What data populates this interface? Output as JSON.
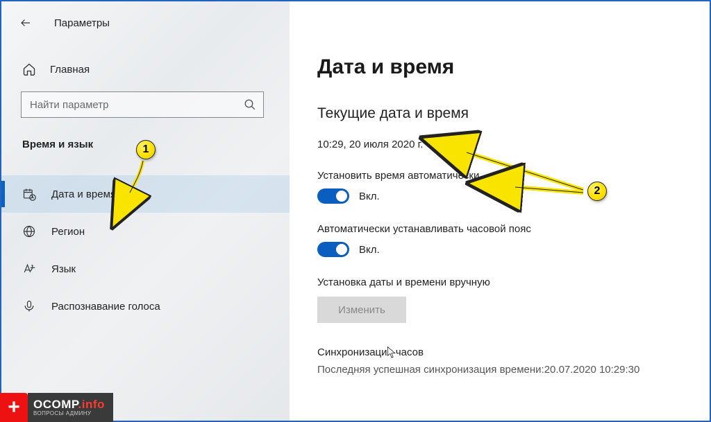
{
  "header": {
    "title": "Параметры"
  },
  "home": {
    "label": "Главная"
  },
  "search": {
    "placeholder": "Найти параметр"
  },
  "group": {
    "title": "Время и язык"
  },
  "nav": {
    "items": [
      {
        "label": "Дата и время"
      },
      {
        "label": "Регион"
      },
      {
        "label": "Язык"
      },
      {
        "label": "Распознавание голоса"
      }
    ]
  },
  "page": {
    "title": "Дата и время",
    "section": "Текущие дата и время",
    "datetime": "10:29, 20 июля 2020 г.",
    "auto_time_label": "Установить время автоматически",
    "auto_time_state": "Вкл.",
    "auto_tz_label": "Автоматически устанавливать часовой пояс",
    "auto_tz_state": "Вкл.",
    "manual_label": "Установка даты и времени вручную",
    "change_btn": "Изменить",
    "sync_title": "Синхронизация часов",
    "sync_detail": "Последняя успешная синхронизация времени:20.07.2020 10:29:30"
  },
  "markers": {
    "one": "1",
    "two": "2"
  },
  "watermark": {
    "main_a": "OCOMP",
    "main_b": ".info",
    "sub": "ВОПРОСЫ АДМИНУ"
  }
}
